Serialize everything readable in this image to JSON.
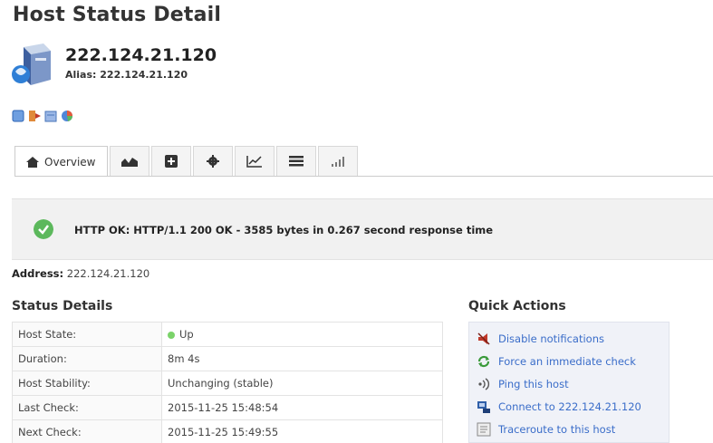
{
  "page": {
    "title": "Host Status Detail"
  },
  "host": {
    "ip": "222.124.21.120",
    "alias_label": "Alias:",
    "alias_value": "222.124.21.120",
    "icon": "host-server-icon"
  },
  "mini_icons": [
    "notes-icon",
    "export-icon",
    "report-icon",
    "graph-icon"
  ],
  "tabs": {
    "overview_label": "Overview",
    "overview_icon": "home-icon",
    "icon_tabs": [
      "trends-icon",
      "plus-box-icon",
      "gear-icon",
      "line-chart-icon",
      "list-icon",
      "signal-bars-icon"
    ]
  },
  "status": {
    "icon": "ok-check-icon",
    "text": "HTTP OK: HTTP/1.1 200 OK - 3585 bytes in 0.267 second response time",
    "color": "#5cb85c"
  },
  "address": {
    "label": "Address:",
    "value": "222.124.21.120"
  },
  "status_details": {
    "title": "Status Details",
    "rows": [
      {
        "key": "Host State:",
        "value": "Up"
      },
      {
        "key": "Duration:",
        "value": "8m 4s"
      },
      {
        "key": "Host Stability:",
        "value": "Unchanging (stable)"
      },
      {
        "key": "Last Check:",
        "value": "2015-11-25 15:48:54"
      },
      {
        "key": "Next Check:",
        "value": "2015-11-25 15:49:55"
      }
    ]
  },
  "quick_actions": {
    "title": "Quick Actions",
    "link_color": "#3a6dc9",
    "items": [
      {
        "label": "Disable notifications",
        "icon": "megaphone-icon"
      },
      {
        "label": "Force an immediate check",
        "icon": "refresh-icon"
      },
      {
        "label": "Ping this host",
        "icon": "ping-icon"
      },
      {
        "label": "Connect to 222.124.21.120",
        "icon": "connect-icon"
      },
      {
        "label": "Traceroute to this host",
        "icon": "traceroute-icon"
      }
    ]
  }
}
